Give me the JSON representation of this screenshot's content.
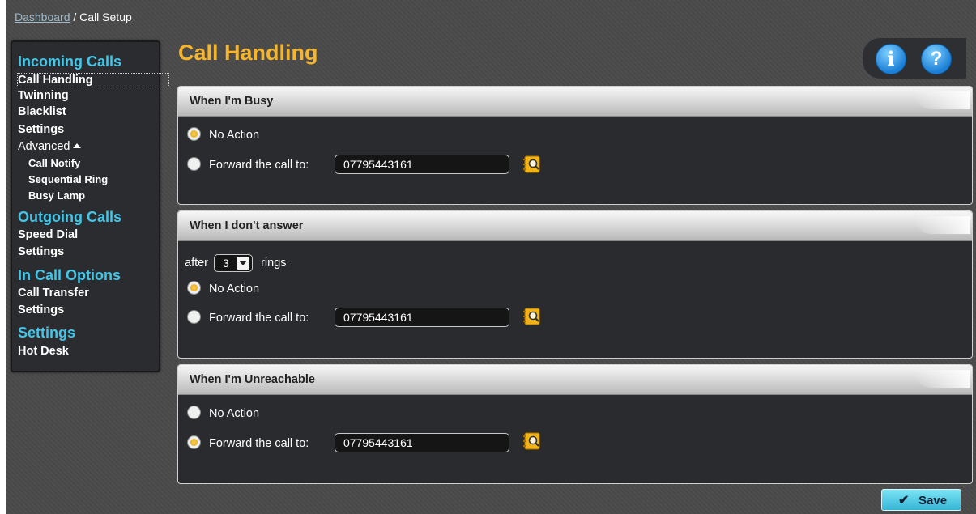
{
  "breadcrumb": {
    "link": "Dashboard",
    "separator": " / ",
    "current": "Call Setup"
  },
  "sidebar": {
    "incoming": {
      "heading": "Incoming Calls",
      "items": [
        "Call Handling",
        "Twinning",
        "Blacklist",
        "Settings"
      ],
      "advanced": "Advanced",
      "sub_items": [
        "Call Notify",
        "Sequential Ring",
        "Busy Lamp"
      ]
    },
    "outgoing": {
      "heading": "Outgoing Calls",
      "items": [
        "Speed Dial",
        "Settings"
      ]
    },
    "in_call": {
      "heading": "In Call Options",
      "items": [
        "Call Transfer",
        "Settings"
      ]
    },
    "settings": {
      "heading": "Settings",
      "items": [
        "Hot Desk"
      ]
    }
  },
  "page_title": "Call Handling",
  "help": {
    "info": "i",
    "question": "?"
  },
  "panels": {
    "busy": {
      "title": "When I'm Busy",
      "no_action": "No Action",
      "forward_label": "Forward the call to:",
      "number": "07795443161",
      "selected": "no_action"
    },
    "no_answer": {
      "title": "When I don't answer",
      "after": "after",
      "rings_value": "3",
      "rings": "rings",
      "no_action": "No Action",
      "forward_label": "Forward the call to:",
      "number": "07795443161",
      "selected": "no_action"
    },
    "unreachable": {
      "title": "When I'm Unreachable",
      "no_action": "No Action",
      "forward_label": "Forward the call to:",
      "number": "07795443161",
      "selected": "forward"
    }
  },
  "save_button": {
    "check": "✔",
    "label": "Save"
  },
  "colors": {
    "accent_orange": "#f7b52c",
    "accent_cyan": "#43c6e8",
    "save_button": "#34b6d6"
  }
}
